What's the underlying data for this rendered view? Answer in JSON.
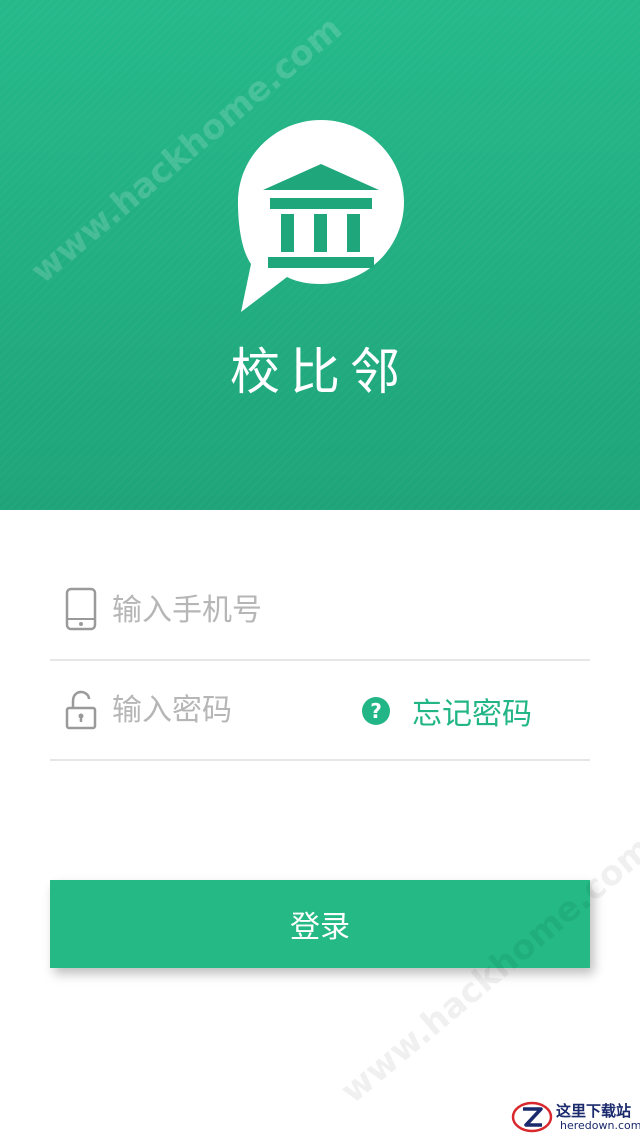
{
  "brand": {
    "name": "校比邻"
  },
  "login_form": {
    "phone_placeholder": "输入手机号",
    "password_placeholder": "输入密码",
    "forgot_password_label": "忘记密码",
    "login_button_label": "登录"
  },
  "icons": {
    "logo": "school-building-speech-bubble-icon",
    "phone_field": "phone-icon",
    "password_field": "lock-icon",
    "forgot_password": "question-circle-icon"
  },
  "overlays": {
    "watermark_text": "www.hackhome.com",
    "badge_title": "这里下载站",
    "badge_url": "heredown.com"
  },
  "colors": {
    "primary": "#22b585",
    "header_gradient_top": "#25b98a",
    "header_gradient_bottom": "#1fa479",
    "placeholder": "#b6b6b6",
    "divider": "#e6e6e6"
  }
}
